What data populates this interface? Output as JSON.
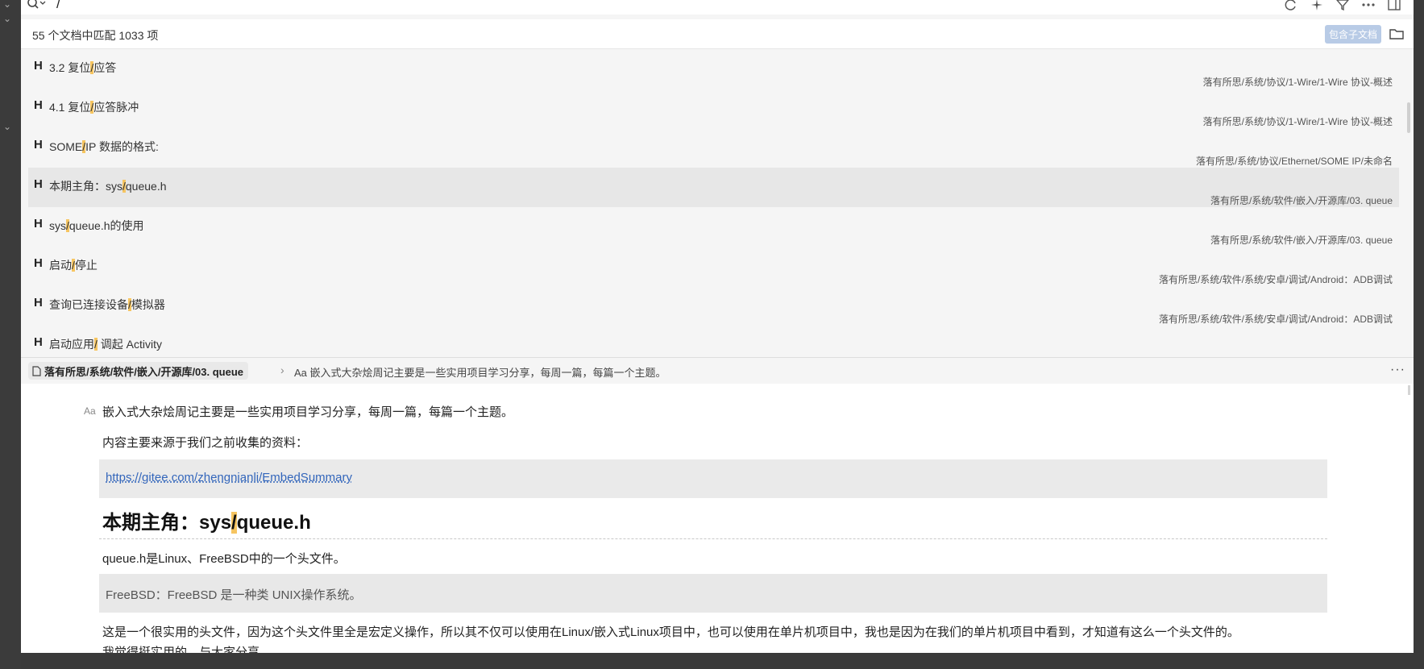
{
  "search": {
    "query": "/"
  },
  "status": {
    "match_count": "55 个文档中匹配 1033 项",
    "include_children_label": "包含子文档"
  },
  "toolbar": {
    "icons": [
      "refresh-icon",
      "sparkle-icon",
      "filter-icon",
      "more-icon",
      "layout-icon"
    ]
  },
  "results": [
    {
      "title_before": "3.2 复位",
      "title_match": "/",
      "title_after": "应答",
      "path": "落有所思/系统/协议/1-Wire/1-Wire 协议-概述"
    },
    {
      "title_before": "4.1 复位",
      "title_match": "/",
      "title_after": "应答脉冲",
      "path": "落有所思/系统/协议/1-Wire/1-Wire 协议-概述"
    },
    {
      "title_before": "SOME",
      "title_match": "/",
      "title_after": "IP 数据的格式:",
      "path": "落有所思/系统/协议/Ethernet/SOME IP/未命名"
    },
    {
      "title_before": "本期主角：sys",
      "title_match": "/",
      "title_after": "queue.h",
      "path": "落有所思/系统/软件/嵌入/开源库/03. queue"
    },
    {
      "title_before": "sys",
      "title_match": "/",
      "title_after": "queue.h的使用",
      "path": "落有所思/系统/软件/嵌入/开源库/03. queue"
    },
    {
      "title_before": "启动",
      "title_match": "/",
      "title_after": "停止",
      "path": "落有所思/系统/软件/系统/安卓/调试/Android：ADB调试"
    },
    {
      "title_before": "查询已连接设备",
      "title_match": "/",
      "title_after": "模拟器",
      "path": "落有所思/系统/软件/系统/安卓/调试/Android：ADB调试"
    },
    {
      "title_before": "启动应用",
      "title_match": "/",
      "title_after": " 调起 Activity",
      "path": ""
    }
  ],
  "breadcrumb": {
    "doc_path": "落有所思/系统/软件/嵌入/开源库/03. queue",
    "block": "Aa 嵌入式大杂烩周记主要是一些实用项目学习分享，每周一篇，每篇一个主题。"
  },
  "editor": {
    "aa_label": "Aa",
    "intro": "嵌入式大杂烩周记主要是一些实用项目学习分享，每周一篇，每篇一个主题。",
    "source_line": "内容主要来源于我们之前收集的资料：",
    "link": "https://gitee.com/zhengnianli/EmbedSummary",
    "heading_before": "本期主角：sys",
    "heading_match": "/",
    "heading_after": "queue.h",
    "para1": "queue.h是Linux、FreeBSD中的一个头文件。",
    "quote": "FreeBSD：FreeBSD 是一种类 UNIX操作系统。",
    "para2": "这是一个很实用的头文件，因为这个头文件里全是宏定义操作，所以其不仅可以使用在Linux/嵌入式Linux项目中，也可以使用在单片机项目中，我也是因为在我们的单片机项目中看到，才知道有这么一个头文件的。",
    "para3": "我觉得挺实用的，与大家分享。"
  },
  "colors": {
    "highlight": "#f6c561",
    "link": "#3366bb",
    "button_bg": "#b8cbe6"
  }
}
